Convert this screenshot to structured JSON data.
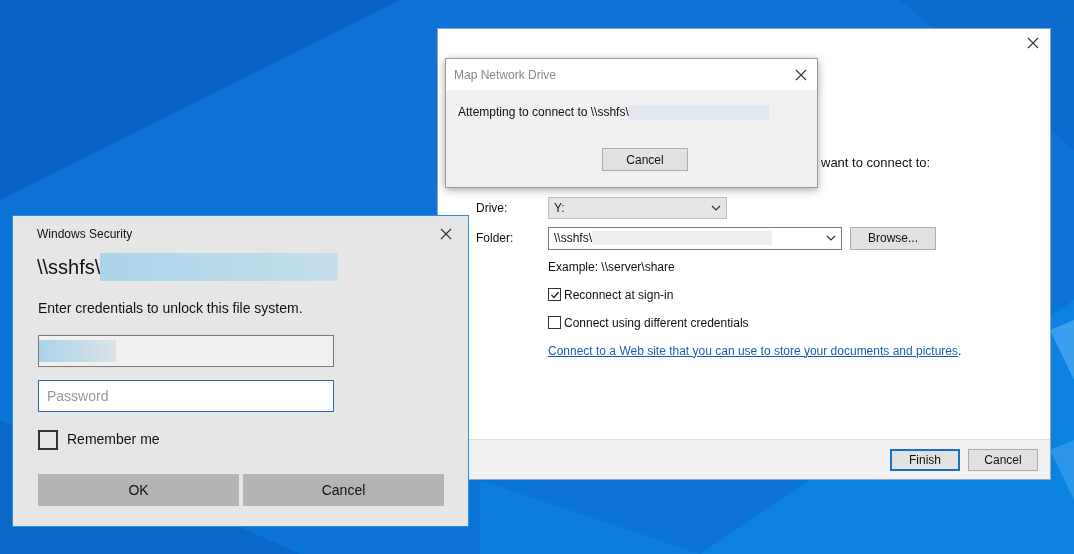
{
  "map_drive_wizard": {
    "partial_instruction": "want to connect to:",
    "drive": {
      "label": "Drive:",
      "value": "Y:"
    },
    "folder": {
      "label": "Folder:",
      "value": "\\\\sshfs\\"
    },
    "browse_button": "Browse...",
    "example": "Example: \\\\server\\share",
    "options": [
      {
        "label": "Reconnect at sign-in",
        "checked": true
      },
      {
        "label": "Connect using different credentials",
        "checked": false
      }
    ],
    "link": {
      "text": "Connect to a Web site that you can use to store your documents and pictures",
      "suffix": "."
    },
    "buttons": [
      {
        "label": "Finish",
        "default": true
      },
      {
        "label": "Cancel",
        "default": false
      }
    ]
  },
  "progress_dialog": {
    "title": "Map Network Drive",
    "message": "Attempting to connect to \\\\sshfs\\",
    "button": "Cancel"
  },
  "security_dialog": {
    "title": "Windows Security",
    "heading": "\\\\sshfs\\",
    "message": "Enter credentials to unlock this file system.",
    "password": {
      "placeholder": "Password"
    },
    "remember_me": {
      "label": "Remember me",
      "checked": false
    },
    "buttons": [
      "OK",
      "Cancel"
    ]
  }
}
